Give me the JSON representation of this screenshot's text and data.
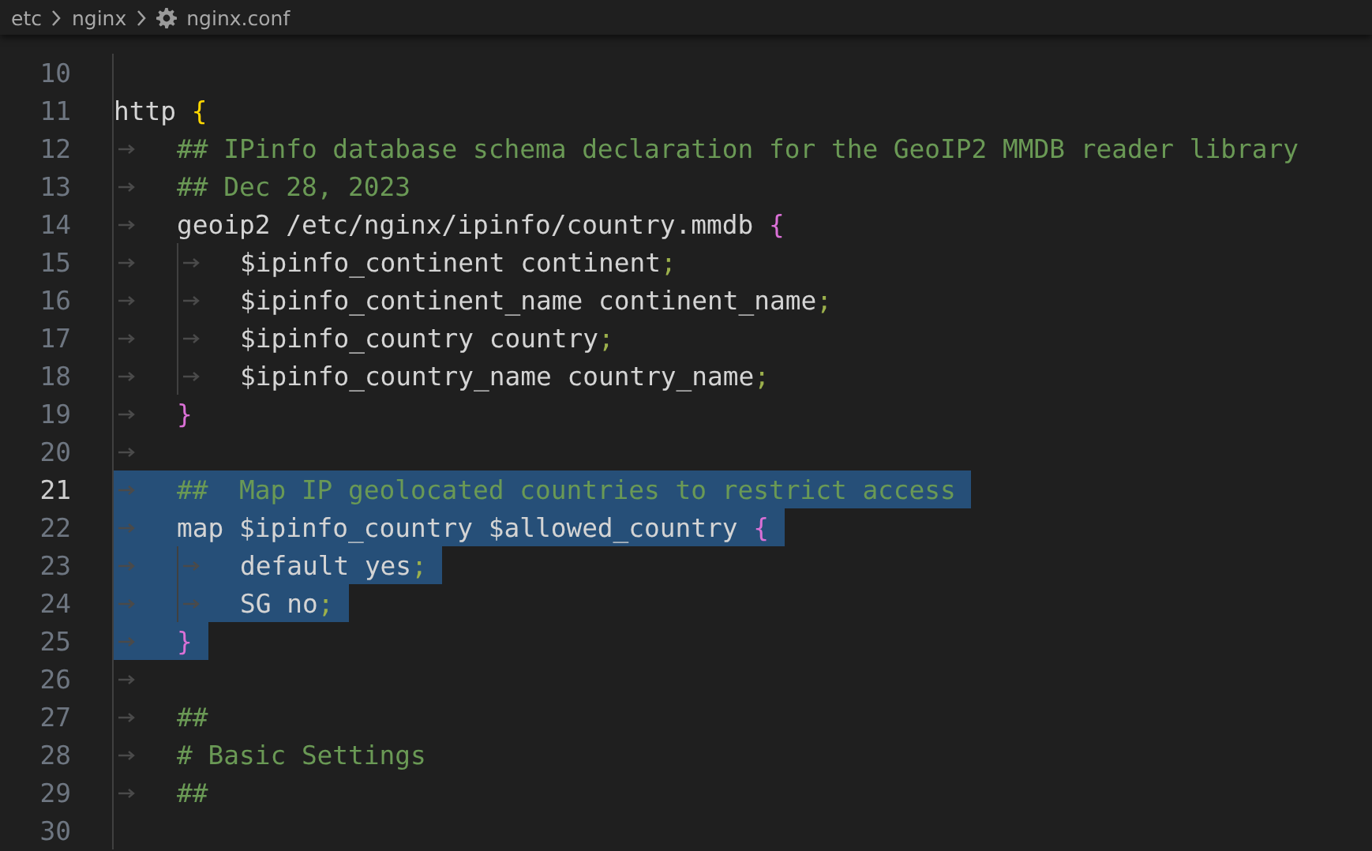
{
  "breadcrumb": [
    {
      "kind": "folder",
      "label": "etc"
    },
    {
      "kind": "folder",
      "label": "nginx"
    },
    {
      "kind": "file",
      "label": "nginx.conf"
    }
  ],
  "lines": [
    {
      "number": "10",
      "selected": false,
      "current": false
    },
    {
      "number": "11",
      "selected": false,
      "current": false,
      "segments": [
        {
          "kind": "plain",
          "text": "http "
        },
        {
          "kind": "bracket",
          "text": "{",
          "color": "#ffd700"
        }
      ]
    },
    {
      "number": "12",
      "selected": false,
      "current": false,
      "segments": [
        {
          "kind": "tab"
        },
        {
          "kind": "comment",
          "text": "## IPinfo database schema declaration for the GeoIP2 MMDB reader library"
        }
      ]
    },
    {
      "number": "13",
      "selected": false,
      "current": false,
      "segments": [
        {
          "kind": "tab"
        },
        {
          "kind": "comment",
          "text": "## Dec 28, 2023"
        }
      ]
    },
    {
      "number": "14",
      "selected": false,
      "current": false,
      "segments": [
        {
          "kind": "tab"
        },
        {
          "kind": "plain",
          "text": "geoip2 /etc/nginx/ipinfo/country.mmdb "
        },
        {
          "kind": "bracket",
          "text": "{",
          "color": "#da70d6"
        }
      ]
    },
    {
      "number": "15",
      "selected": false,
      "current": false,
      "segments": [
        {
          "kind": "tab"
        },
        {
          "kind": "tab"
        },
        {
          "kind": "plain",
          "text": "$ipinfo_continent continent"
        },
        {
          "kind": "punct",
          "text": ";"
        }
      ]
    },
    {
      "number": "16",
      "selected": false,
      "current": false,
      "segments": [
        {
          "kind": "tab"
        },
        {
          "kind": "tab"
        },
        {
          "kind": "plain",
          "text": "$ipinfo_continent_name continent_name"
        },
        {
          "kind": "punct",
          "text": ";"
        }
      ]
    },
    {
      "number": "17",
      "selected": false,
      "current": false,
      "segments": [
        {
          "kind": "tab"
        },
        {
          "kind": "tab"
        },
        {
          "kind": "plain",
          "text": "$ipinfo_country country"
        },
        {
          "kind": "punct",
          "text": ";"
        }
      ]
    },
    {
      "number": "18",
      "selected": false,
      "current": false,
      "segments": [
        {
          "kind": "tab"
        },
        {
          "kind": "tab"
        },
        {
          "kind": "plain",
          "text": "$ipinfo_country_name country_name"
        },
        {
          "kind": "punct",
          "text": ";"
        }
      ]
    },
    {
      "number": "19",
      "selected": false,
      "current": false,
      "segments": [
        {
          "kind": "tab"
        },
        {
          "kind": "bracket",
          "text": "}",
          "color": "#da70d6"
        }
      ]
    },
    {
      "number": "20",
      "selected": false,
      "current": false,
      "segments": [
        {
          "kind": "tab"
        }
      ]
    },
    {
      "number": "21",
      "selected": true,
      "current": true,
      "segments": [
        {
          "kind": "tab"
        },
        {
          "kind": "comment",
          "text": "##  Map IP geolocated countries to restrict access"
        }
      ]
    },
    {
      "number": "22",
      "selected": true,
      "current": false,
      "segments": [
        {
          "kind": "tab"
        },
        {
          "kind": "plain",
          "text": "map $ipinfo_country $allowed_country "
        },
        {
          "kind": "bracket",
          "text": "{",
          "color": "#da70d6"
        }
      ]
    },
    {
      "number": "23",
      "selected": true,
      "current": false,
      "segments": [
        {
          "kind": "tab"
        },
        {
          "kind": "tab"
        },
        {
          "kind": "plain",
          "text": "default yes"
        },
        {
          "kind": "punct",
          "text": ";"
        }
      ]
    },
    {
      "number": "24",
      "selected": true,
      "current": false,
      "segments": [
        {
          "kind": "tab"
        },
        {
          "kind": "tab"
        },
        {
          "kind": "plain",
          "text": "SG no"
        },
        {
          "kind": "punct",
          "text": ";"
        }
      ]
    },
    {
      "number": "25",
      "selected": true,
      "current": false,
      "segments": [
        {
          "kind": "tab"
        },
        {
          "kind": "bracket",
          "text": "}",
          "color": "#da70d6"
        }
      ]
    },
    {
      "number": "26",
      "selected": false,
      "current": false,
      "segments": [
        {
          "kind": "tab"
        }
      ]
    },
    {
      "number": "27",
      "selected": false,
      "current": false,
      "segments": [
        {
          "kind": "tab"
        },
        {
          "kind": "comment",
          "text": "##"
        }
      ]
    },
    {
      "number": "28",
      "selected": false,
      "current": false,
      "segments": [
        {
          "kind": "tab"
        },
        {
          "kind": "comment",
          "text": "# Basic Settings"
        }
      ]
    },
    {
      "number": "29",
      "selected": false,
      "current": false,
      "segments": [
        {
          "kind": "tab"
        },
        {
          "kind": "comment",
          "text": "##"
        }
      ]
    },
    {
      "number": "30",
      "selected": false,
      "current": false
    }
  ]
}
